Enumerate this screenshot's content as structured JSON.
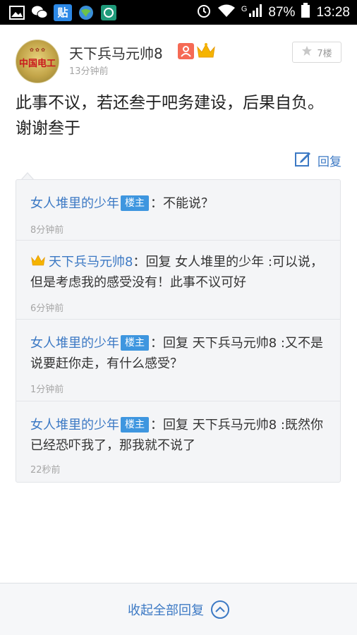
{
  "status_bar": {
    "battery": "87%",
    "time": "13:28",
    "network": "G",
    "icons": [
      "gallery-icon",
      "wechat-icon",
      "tieba-icon",
      "browser-icon",
      "app-icon",
      "alarm-icon",
      "wifi-icon",
      "signal-icon",
      "battery-icon"
    ],
    "tieba_label": "贴"
  },
  "post": {
    "avatar_text": "中国电工",
    "username": "天下兵马元帅8",
    "time": "13分钟前",
    "floor": "7楼",
    "content": "此事不议，若还叁于吧务建设，后果自负。谢谢叁于",
    "reply_label": "回复"
  },
  "comments": [
    {
      "author": "女人堆里的少年",
      "is_op": true,
      "op_label": "楼主",
      "text": "：不能说？",
      "time": "8分钟前"
    },
    {
      "author": "天下兵马元帅8",
      "is_op": false,
      "crown": true,
      "text": "：回复 女人堆里的少年 :可以说，但是考虑我的感受没有！此事不议可好",
      "time": "6分钟前"
    },
    {
      "author": "女人堆里的少年",
      "is_op": true,
      "op_label": "楼主",
      "text": "：回复 天下兵马元帅8 :又不是说要赶你走，有什么感受？",
      "time": "1分钟前"
    },
    {
      "author": "女人堆里的少年",
      "is_op": true,
      "op_label": "楼主",
      "text": "：回复 天下兵马元帅8 :既然你已经恐吓我了，那我就不说了",
      "time": "22秒前"
    }
  ],
  "bottom": {
    "collapse_label": "收起全部回复"
  },
  "colors": {
    "link": "#3c79c4",
    "op_badge": "#3e96df",
    "user_badge": "#f56a55",
    "crown": "#f5b400"
  }
}
